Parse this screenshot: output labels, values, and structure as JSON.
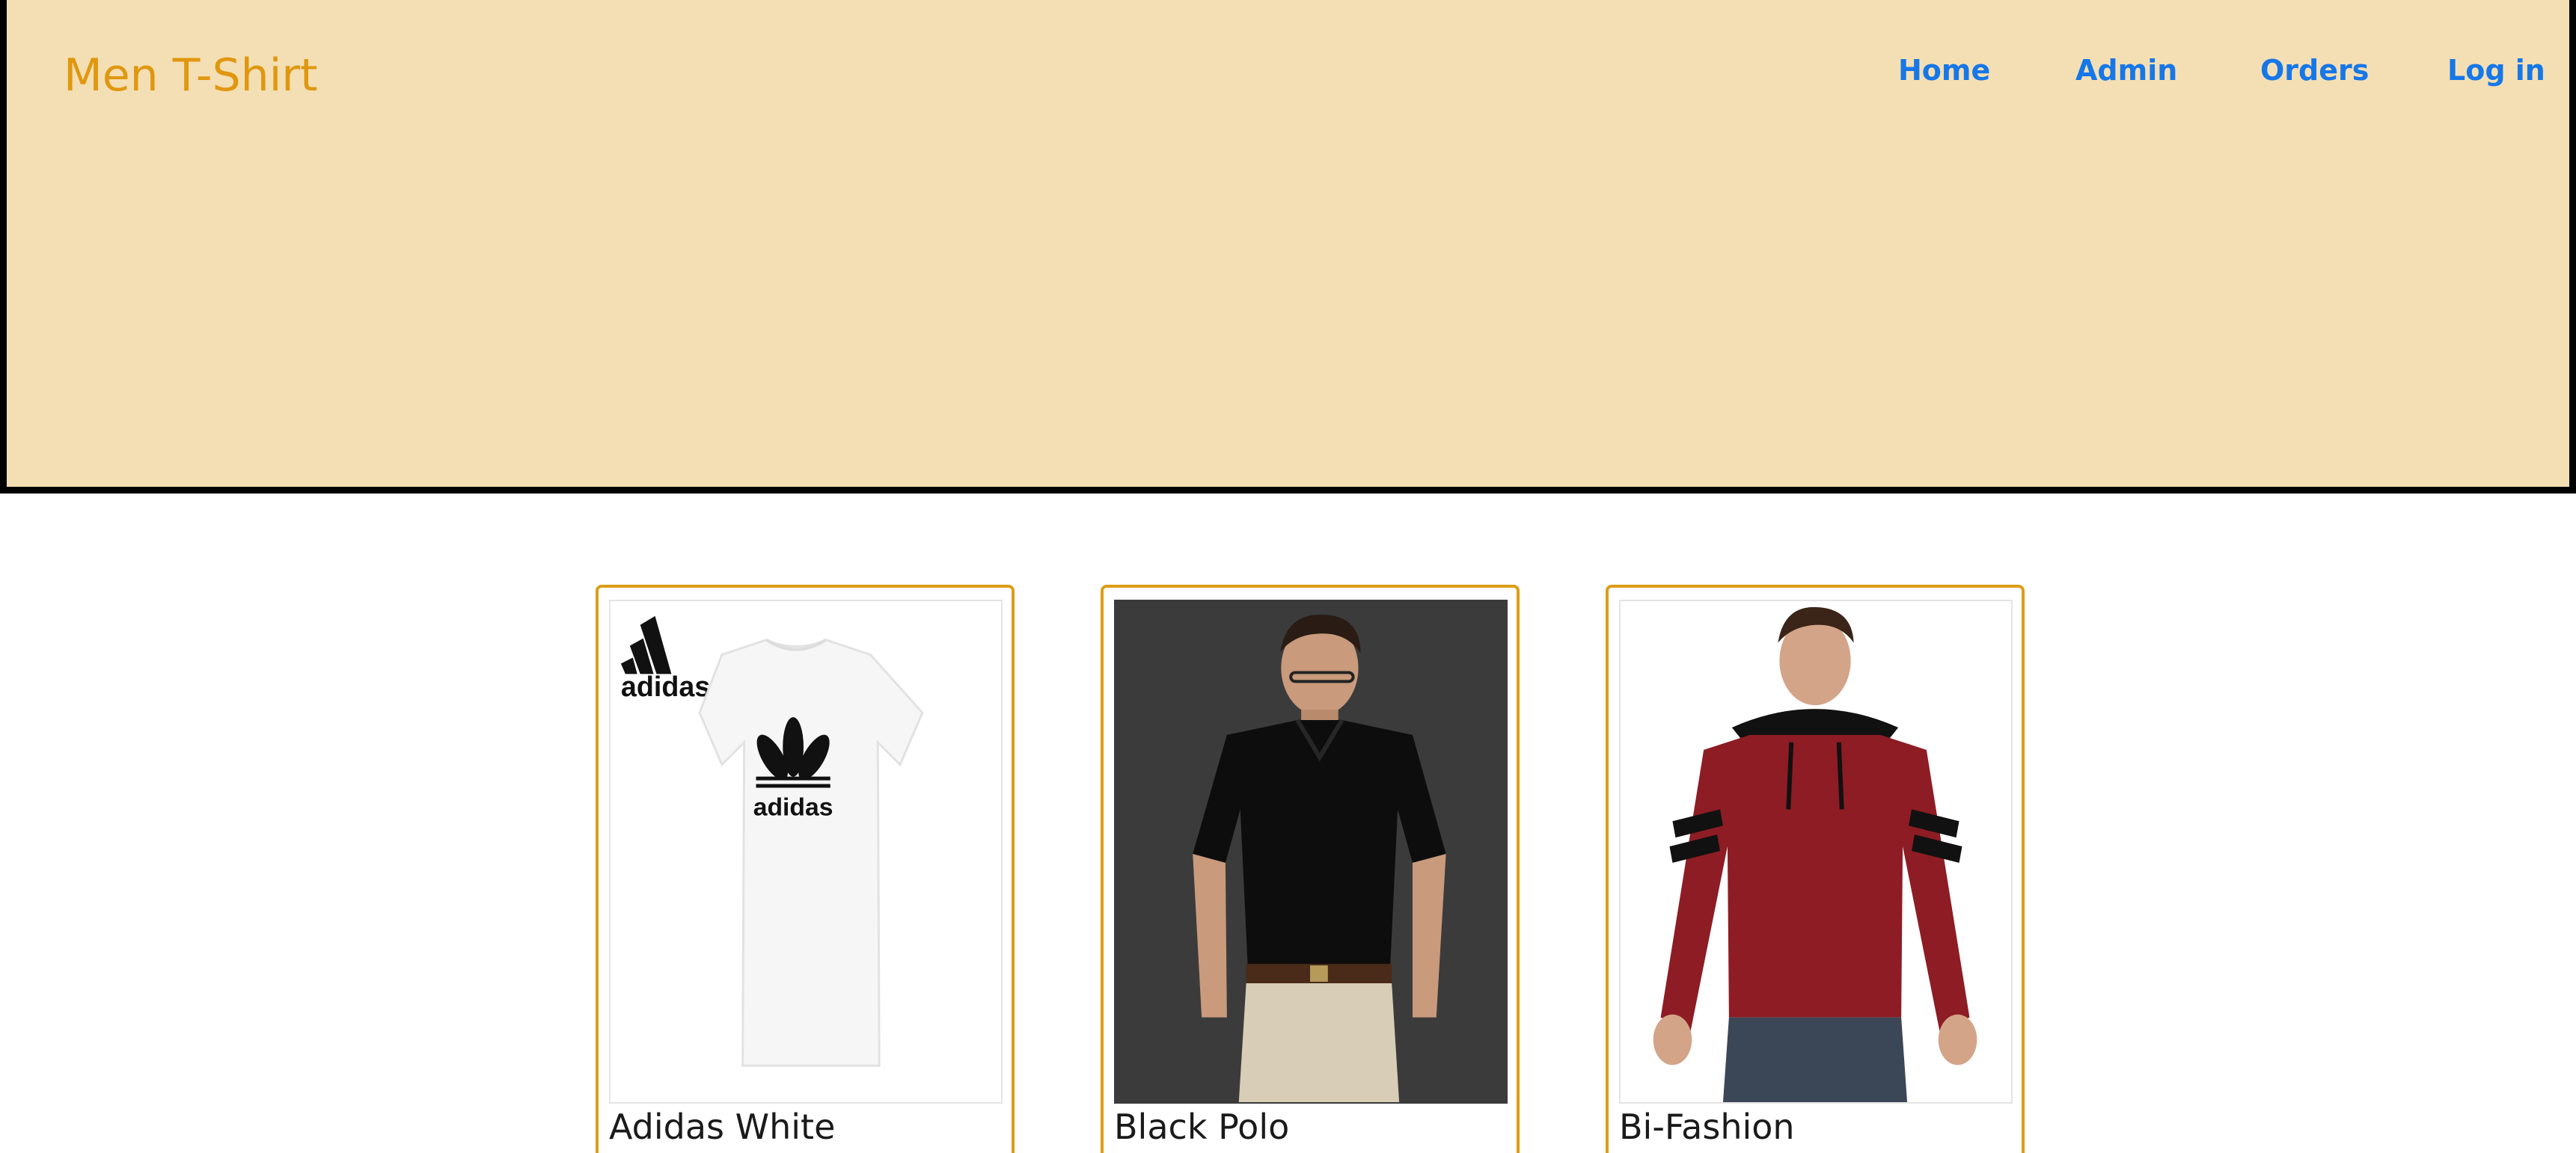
{
  "brand": {
    "title": "Men T-Shirt"
  },
  "nav": {
    "items": [
      {
        "label": "Home"
      },
      {
        "label": "Admin"
      },
      {
        "label": "Orders"
      },
      {
        "label": "Log in"
      }
    ]
  },
  "products": [
    {
      "name": "Adidas White",
      "image": "white-adidas-tshirt",
      "logo_text": "adidas",
      "print_text": "adidas"
    },
    {
      "name": "Black Polo",
      "image": "black-polo-shirt"
    },
    {
      "name": "Bi-Fashion",
      "image": "maroon-hooded-tshirt"
    }
  ],
  "colors": {
    "header_bg": "#f4dfb4",
    "brand": "#e0970f",
    "nav_link": "#1677e8",
    "card_border": "#dc9d17"
  }
}
